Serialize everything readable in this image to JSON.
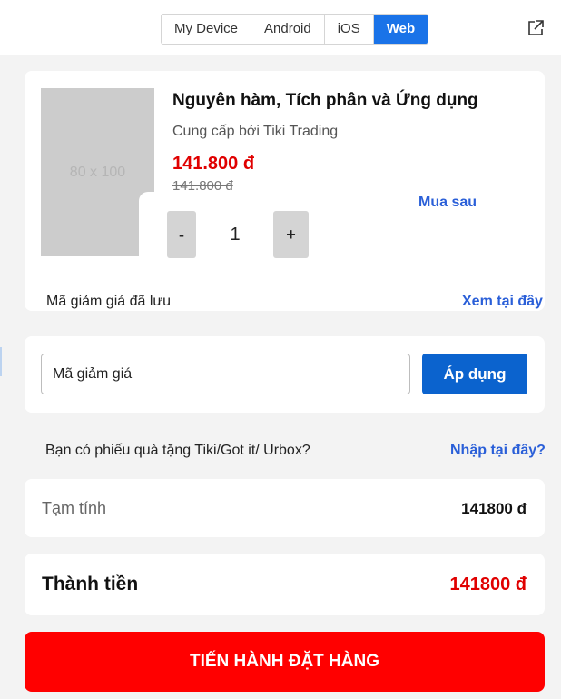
{
  "platform_tabs": {
    "items": [
      "My Device",
      "Android",
      "iOS",
      "Web"
    ],
    "active": "Web"
  },
  "product": {
    "thumbnail_text": "80 x 100",
    "title": "Nguyên hàm, Tích phân và Ứng dụng",
    "seller": "Cung cấp bởi Tiki Trading",
    "price": "141.800 đ",
    "old_price": "141.800 đ",
    "buy_later": "Mua sau",
    "qty_minus": "-",
    "qty_value": "1",
    "qty_plus": "+"
  },
  "saved_coupon": {
    "label": "Mã giảm giá đã lưu",
    "link": "Xem tại đây"
  },
  "coupon": {
    "value": "Mã giảm giá",
    "apply_label": "Áp dụng"
  },
  "gift": {
    "question": "Bạn có phiếu quà tặng Tiki/Got it/ Urbox?",
    "link": "Nhập tại đây?"
  },
  "subtotal": {
    "label": "Tạm tính",
    "value": "141800 đ"
  },
  "total": {
    "label": "Thành tiền",
    "value": "141800 đ"
  },
  "checkout_label": "TIẾN HÀNH ĐẶT HÀNG",
  "colors": {
    "accent_blue": "#1a73e8",
    "link_blue": "#2a5fd8",
    "price_red": "#e00000",
    "checkout_red": "#ff0000",
    "apply_blue": "#0b63ce"
  },
  "icons": {
    "external_link": "external-link-icon"
  }
}
